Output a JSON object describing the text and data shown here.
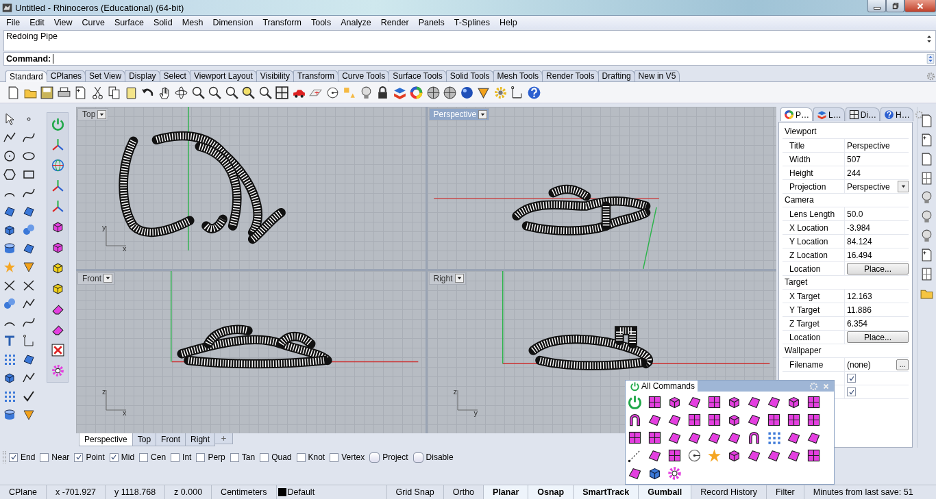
{
  "window": {
    "title": "Untitled - Rhinoceros (Educational) (64-bit)"
  },
  "menu": [
    "File",
    "Edit",
    "View",
    "Curve",
    "Surface",
    "Solid",
    "Mesh",
    "Dimension",
    "Transform",
    "Tools",
    "Analyze",
    "Render",
    "Panels",
    "T-Splines",
    "Help"
  ],
  "command": {
    "history": "Redoing Pipe",
    "prompt": "Command:"
  },
  "toolbar_tabs": [
    {
      "label": "Standard",
      "selected": true
    },
    {
      "label": "CPlanes",
      "selected": false
    },
    {
      "label": "Set View",
      "selected": false
    },
    {
      "label": "Display",
      "selected": false
    },
    {
      "label": "Select",
      "selected": false
    },
    {
      "label": "Viewport Layout",
      "selected": false
    },
    {
      "label": "Visibility",
      "selected": false
    },
    {
      "label": "Transform",
      "selected": false
    },
    {
      "label": "Curve Tools",
      "selected": false
    },
    {
      "label": "Surface Tools",
      "selected": false
    },
    {
      "label": "Solid Tools",
      "selected": false
    },
    {
      "label": "Mesh Tools",
      "selected": false
    },
    {
      "label": "Render Tools",
      "selected": false
    },
    {
      "label": "Drafting",
      "selected": false
    },
    {
      "label": "New in V5",
      "selected": false
    }
  ],
  "viewports": [
    {
      "title": "Top",
      "selected": false,
      "axis_labels": [
        "y",
        "x"
      ]
    },
    {
      "title": "Perspective",
      "selected": true
    },
    {
      "title": "Front",
      "selected": false,
      "axis_labels": [
        "z",
        "x"
      ]
    },
    {
      "title": "Right",
      "selected": false,
      "axis_labels": [
        "z",
        "y"
      ]
    }
  ],
  "viewport_tabs": [
    {
      "label": "Perspective",
      "selected": true
    },
    {
      "label": "Top",
      "selected": false
    },
    {
      "label": "Front",
      "selected": false
    },
    {
      "label": "Right",
      "selected": false
    }
  ],
  "properties": {
    "tabs": [
      {
        "label": "P…",
        "selected": true
      },
      {
        "label": "L…",
        "selected": false
      },
      {
        "label": "Di…",
        "selected": false
      },
      {
        "label": "H…",
        "selected": false
      }
    ],
    "sections": [
      {
        "title": "Viewport",
        "rows": [
          {
            "label": "Title",
            "kind": "text",
            "value": "Perspective"
          },
          {
            "label": "Width",
            "kind": "text",
            "value": "507"
          },
          {
            "label": "Height",
            "kind": "text",
            "value": "244"
          },
          {
            "label": "Projection",
            "kind": "dropdown",
            "value": "Perspective"
          }
        ]
      },
      {
        "title": "Camera",
        "rows": [
          {
            "label": "Lens Length",
            "kind": "text",
            "value": "50.0"
          },
          {
            "label": "X Location",
            "kind": "text",
            "value": "-3.984"
          },
          {
            "label": "Y Location",
            "kind": "text",
            "value": "84.124"
          },
          {
            "label": "Z Location",
            "kind": "text",
            "value": "16.494"
          },
          {
            "label": "Location",
            "kind": "button",
            "value": "Place..."
          }
        ]
      },
      {
        "title": "Target",
        "rows": [
          {
            "label": "X Target",
            "kind": "text",
            "value": "12.163"
          },
          {
            "label": "Y Target",
            "kind": "text",
            "value": "11.886"
          },
          {
            "label": "Z Target",
            "kind": "text",
            "value": "6.354"
          },
          {
            "label": "Location",
            "kind": "button",
            "value": "Place..."
          }
        ]
      },
      {
        "title": "Wallpaper",
        "rows": [
          {
            "label": "Filename",
            "kind": "file",
            "value": "(none)",
            "button": "..."
          },
          {
            "kind": "check",
            "checked": true
          },
          {
            "kind": "check",
            "checked": true
          }
        ]
      }
    ]
  },
  "floating_toolbar": {
    "title": "All Commands"
  },
  "osnaps": [
    {
      "label": "End",
      "kind": "check",
      "checked": true
    },
    {
      "label": "Near",
      "kind": "check",
      "checked": false
    },
    {
      "label": "Point",
      "kind": "check",
      "checked": true
    },
    {
      "label": "Mid",
      "kind": "check",
      "checked": true
    },
    {
      "label": "Cen",
      "kind": "check",
      "checked": false
    },
    {
      "label": "Int",
      "kind": "check",
      "checked": false
    },
    {
      "label": "Perp",
      "kind": "check",
      "checked": false
    },
    {
      "label": "Tan",
      "kind": "check",
      "checked": false
    },
    {
      "label": "Quad",
      "kind": "check",
      "checked": false
    },
    {
      "label": "Knot",
      "kind": "check",
      "checked": false
    },
    {
      "label": "Vertex",
      "kind": "check",
      "checked": false
    },
    {
      "label": "Project",
      "kind": "toggle",
      "checked": false
    },
    {
      "label": "Disable",
      "kind": "toggle",
      "checked": false
    }
  ],
  "status_bar": [
    {
      "text": "CPlane",
      "kind": "info"
    },
    {
      "text": "x -701.927",
      "kind": "info"
    },
    {
      "text": "y 1118.768",
      "kind": "info"
    },
    {
      "text": "z 0.000",
      "kind": "info"
    },
    {
      "text": "Centimeters",
      "kind": "info"
    },
    {
      "text": "Default",
      "kind": "layer",
      "color": "#000000"
    },
    {
      "text": "Grid Snap",
      "kind": "toggle",
      "on": false
    },
    {
      "text": "Ortho",
      "kind": "toggle",
      "on": false
    },
    {
      "text": "Planar",
      "kind": "toggle",
      "on": true
    },
    {
      "text": "Osnap",
      "kind": "toggle",
      "on": true
    },
    {
      "text": "SmartTrack",
      "kind": "toggle",
      "on": true
    },
    {
      "text": "Gumball",
      "kind": "toggle",
      "on": true
    },
    {
      "text": "Record History",
      "kind": "toggle",
      "on": false
    },
    {
      "text": "Filter",
      "kind": "toggle",
      "on": false
    },
    {
      "text": "Minutes from last save: 51",
      "kind": "info"
    }
  ]
}
